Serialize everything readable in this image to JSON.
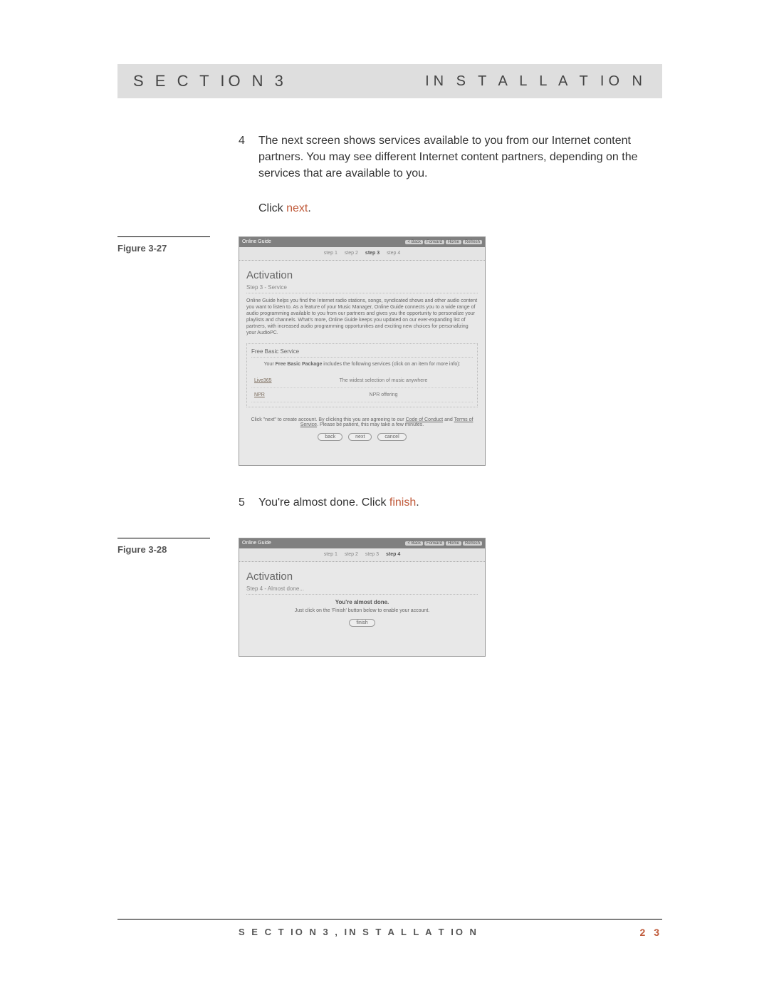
{
  "header": {
    "left": "S E C T IO N  3",
    "right": "IN S T A L L A T IO N"
  },
  "steps": {
    "s4": {
      "num": "4",
      "text": "The next screen shows services available to you from our Internet content partners.  You may see different Internet content partners, depending on the services that are available to you."
    },
    "click4_pre": "Click ",
    "click4_link": "next",
    "click4_post": ".",
    "s5": {
      "num": "5",
      "text_pre": "You're almost done.  Click ",
      "text_link": "finish",
      "text_post": "."
    }
  },
  "figures": {
    "f27": "Figure 3-27",
    "f28": "Figure 3-28"
  },
  "shot1": {
    "title": "Online Guide",
    "btns": [
      "< Back",
      "Forward",
      "Home",
      "Refresh"
    ],
    "tabs": [
      "step 1",
      "step 2",
      "step 3",
      "step 4"
    ],
    "h1": "Activation",
    "sub": "Step 3 - Service",
    "para": "Online Guide helps you find the Internet radio stations, songs, syndicated shows and other audio content you want to listen to. As a feature of your Music Manager, Online Guide connects you to a wide range of audio programming available to you from our partners and gives you the opportunity to personalize your playlists and channels. What's more, Online Guide keeps you updated on our ever-expanding list of partners, with increased audio programming opportunities and exciting new choices for personalizing your AudioPC.",
    "fbs_title": "Free Basic Service",
    "fbs_desc_pre": "Your ",
    "fbs_desc_bold": "Free Basic Package",
    "fbs_desc_post": " includes the following services (click on an item for more info):",
    "row1_name": "Live365",
    "row1_text": "The widest selection of music anywhere",
    "row2_name": "NPR",
    "row2_text": "NPR offering",
    "agree_pre": "Click \"next\" to create account. By clicking this you are agreeing to our ",
    "agree_link1": "Code of Conduct",
    "agree_mid": " and ",
    "agree_link2": "Terms of Service",
    "agree_post": ". Please be patient, this may take a few minutes.",
    "btn_back": "back",
    "btn_next": "next",
    "btn_cancel": "cancel"
  },
  "shot2": {
    "title": "Online Guide",
    "btns": [
      "< Back",
      "Forward",
      "Home",
      "Refresh"
    ],
    "tabs": [
      "step 1",
      "step 2",
      "step 3",
      "step 4"
    ],
    "h1": "Activation",
    "sub": "Step 4 - Almost done...",
    "almost_t": "You're almost done.",
    "almost_d": "Just click on the 'Finish' button below to enable your account.",
    "btn_finish": "finish"
  },
  "footer": {
    "left": "S E C T IO N  3 , IN S T A L L A T IO N",
    "right": "2 3"
  }
}
